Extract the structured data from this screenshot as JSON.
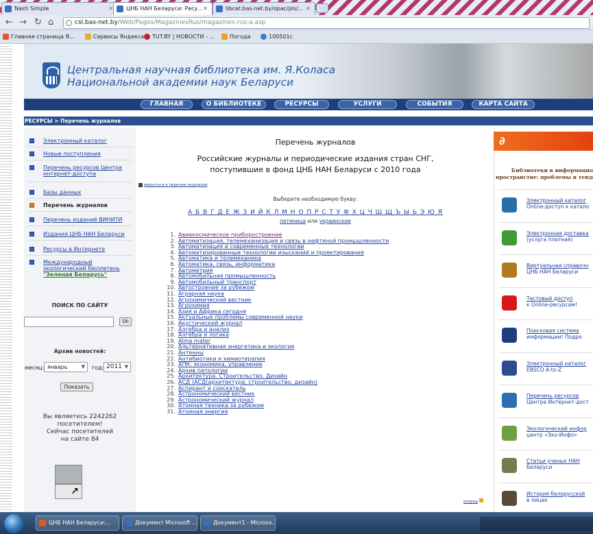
{
  "browser": {
    "tabs": [
      {
        "label": "Nasti Simple",
        "active": false
      },
      {
        "label": "ЦНБ НАН Беларуси: Ресу...",
        "active": true
      },
      {
        "label": "libcat.bas-net.by/opac/pls/...",
        "active": false
      }
    ],
    "url_host": "csl.bas-net.by",
    "url_path": "/Web/Pages/MagazinesRus/magazines-rus-a.asp",
    "bookmarks": [
      "Главная страница Я...",
      "Сервисы Яндекса",
      "TUT.BY | НОВОСТИ - ...",
      "Погода",
      "100501c"
    ]
  },
  "header": {
    "title_line1": "Центральная научная библиотека им. Я.Коласа",
    "title_line2": "Национальной академии наук Беларуси"
  },
  "menu": [
    "ГЛАВНАЯ",
    "О БИБЛИОТЕКЕ",
    "РЕСУРСЫ",
    "УСЛУГИ",
    "СОБЫТИЯ",
    "КАРТА САЙТА"
  ],
  "breadcrumb": "РЕСУРСЫ > Перечень журналов",
  "sidebar": {
    "items": [
      {
        "label": "Электронный каталог",
        "label2": "",
        "label3": "",
        "current": false
      },
      {
        "label": "Новые поступления",
        "label2": "",
        "label3": "",
        "current": false
      },
      {
        "label": "Перечень ресурсов Центра",
        "label2": "интернет-доступа",
        "label3": "",
        "current": false
      },
      {
        "label": "Базы данных",
        "label2": "",
        "label3": "",
        "current": false
      },
      {
        "label": "Перечень журналов",
        "label2": "",
        "label3": "",
        "current": true
      },
      {
        "label": "Перечень изданий ВИНИТИ",
        "label2": "",
        "label3": "",
        "current": false
      },
      {
        "label": "Издания ЦНБ НАН Беларуси",
        "label2": "",
        "label3": "",
        "current": false
      },
      {
        "label": "Ресурсы в Интернете",
        "label2": "",
        "label3": "",
        "current": false
      },
      {
        "label": "Международный",
        "label2": "экологический бюллетень",
        "label3": "\"Зеленая Беларусь\"",
        "current": false
      }
    ],
    "search_label": "ПОИСК ПО САЙТУ",
    "search_button": "Ok",
    "archive_label": "Архив новостей:",
    "month_label": "месяц:",
    "month_value": "январь",
    "year_label": "год:",
    "year_value": "2011",
    "show_button": "Показать",
    "visitor_line1": "Вы являетесь 2242262",
    "visitor_line2": "посетителем!",
    "visitor_line3": "Сейчас посетителей",
    "visitor_line4": "на сайте 84"
  },
  "main": {
    "title": "Перечень журналов",
    "subtitle_line1": "Российские журналы и периодические издания стран СНГ,",
    "subtitle_line2": "поступившие в фонд ЦНБ НАН Беларуси с 2010 года",
    "back_link": "вернуться к перечню журналов",
    "choose_label": "Выберите необходимую букву:",
    "alphabet": "А Б В Г Д Е Ж З И Й К Л М Н О П Р С Т У Ф Х Ц Ч Ш Щ Ъ Ы Ь Э Ю Я",
    "latin_link": "латиница",
    "or_text": "или",
    "ukr_link": "украинские",
    "journals": [
      "Авиакосмическое приборостроение",
      "Автоматизация, телемеханизация и связь в нефтяной промышленности",
      "Автоматизация и современные технологии",
      "Автоматизированные технологии изысканий и проектирования",
      "Автоматика и телемеханика",
      "Автоматика, связь, информатика",
      "Автометрия",
      "Автомобильная промышленность",
      "Автомобильный транспорт",
      "Автостроение за рубежом",
      "Аграрная наука",
      "Агрохимический вестник",
      "Агрохимия",
      "Азия и Африка сегодня",
      "Актуальные проблемы современной науки",
      "Акустический журнал",
      "Алгебра и анализ",
      "Алгебра и логика",
      "Alma mater",
      "Альтернативная энергетика и экология",
      "Антенны",
      "Антибиотики и химиотерапия",
      "АПК: экономика, управление",
      "Архив патологии",
      "Архитектура. Строительство. Дизайн",
      "АСД (АСД(архитектура, строительство, дизайн)",
      "Аспирант и соискатель",
      "Астрономический вестник",
      "Астрономический журнал",
      "Атомная техника за рубежом",
      "Атомная энергия"
    ],
    "forward_link": "вперед"
  },
  "rightcol": {
    "top_glyph": "∂",
    "lib_line1": "Библиотеки в информацио",
    "lib_line2": "пространстве: проблемы и тенде",
    "items": [
      {
        "title": "Электронный каталог",
        "sub": "Online-доступ к катало",
        "icon": "catalog-icon",
        "color": "#2a6ea8"
      },
      {
        "title": "Электронная доставка",
        "sub": "(услуга платная)",
        "icon": "delivery-icon",
        "color": "#3f9a35"
      },
      {
        "title": "Виртуальная справочн",
        "sub": "ЦНБ НАН Беларуси",
        "icon": "reference-icon",
        "color": "#b07a20"
      },
      {
        "title": "Тестовый доступ",
        "sub": "к Online-ресурсам!",
        "icon": "exclamation-icon",
        "color": "#d81818"
      },
      {
        "title": "Поисковая система",
        "sub": "информации! Подро",
        "icon": "scirus-icon",
        "color": "#1d3f80"
      },
      {
        "title": "Электронный каталог",
        "sub": "EBSCO A-to-Z",
        "icon": "ebsco-icon",
        "color": "#2b4d8e"
      },
      {
        "title": "Перечень ресурсов",
        "sub": "Центра Интернет-дост",
        "icon": "globe-icon",
        "color": "#2d6fb0"
      },
      {
        "title": "Экологический инфор",
        "sub": "центр «Эко-Инфо»",
        "icon": "eco-icon",
        "color": "#6fa040"
      },
      {
        "title": "Статьи ученых НАН",
        "sub": "Беларуси",
        "icon": "pen-icon",
        "color": "#7a7a50"
      },
      {
        "title": "История белорусской",
        "sub": "в лицах",
        "icon": "history-icon",
        "color": "#5a4a3a"
      }
    ]
  },
  "taskbar": {
    "items": [
      "ЦНБ НАН Беларуси:...",
      "Документ Microsoft ...",
      "Документ1 - Microso..."
    ]
  }
}
